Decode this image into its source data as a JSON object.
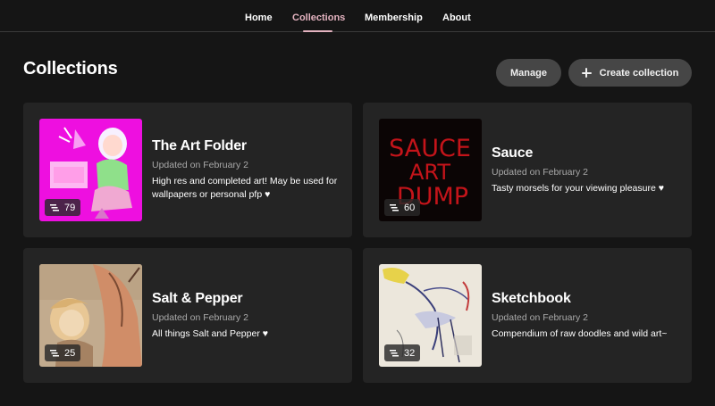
{
  "nav": {
    "items": [
      {
        "label": "Home"
      },
      {
        "label": "Collections"
      },
      {
        "label": "Membership"
      },
      {
        "label": "About"
      }
    ],
    "active": "Collections"
  },
  "page": {
    "title": "Collections",
    "manage_label": "Manage",
    "create_label": "Create collection"
  },
  "collections": [
    {
      "title": "The Art Folder",
      "updated": "Updated on February 2",
      "description": "High res and completed art! May be used for wallpapers or personal pfp ♥",
      "count": "79"
    },
    {
      "title": "Sauce",
      "updated": "Updated on February 2",
      "description": "Tasty morsels for your viewing pleasure ♥",
      "count": "60"
    },
    {
      "title": "Salt & Pepper",
      "updated": "Updated on February 2",
      "description": "All things Salt and Pepper ♥",
      "count": "25"
    },
    {
      "title": "Sketchbook",
      "updated": "Updated on February 2",
      "description": "Compendium of raw doodles and wild art~",
      "count": "32"
    }
  ],
  "thumb_art": {
    "sauce_text": [
      "SAUCE",
      "ART",
      "DUMP"
    ]
  },
  "colors": {
    "accent": "#e4b3c0",
    "background": "#151515",
    "card": "#242424",
    "button": "#464646"
  }
}
